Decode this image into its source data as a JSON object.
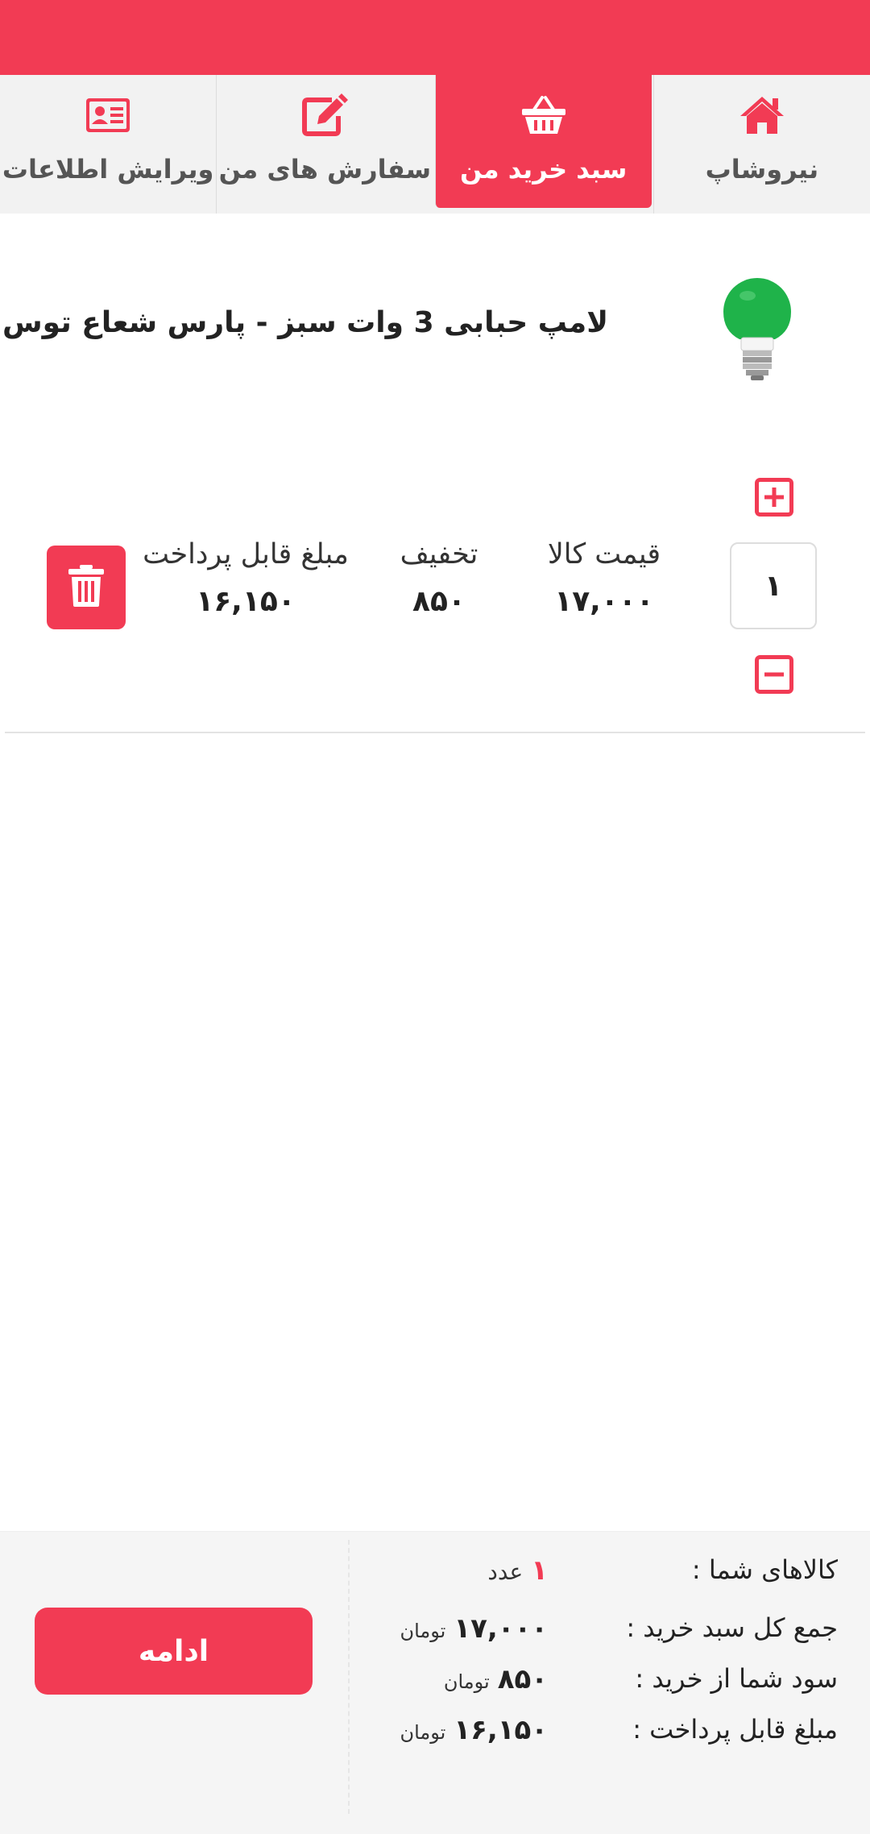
{
  "tabs": [
    {
      "label": "نیروشاپ",
      "icon": "home-icon"
    },
    {
      "label": "سبد خرید من",
      "icon": "basket-icon"
    },
    {
      "label": "سفارش های من",
      "icon": "edit-icon"
    },
    {
      "label": "ویرایش اطلاعات",
      "icon": "id-card-icon"
    }
  ],
  "product": {
    "title": "لامپ حبابی 3 وات سبز - پارس شعاع توس",
    "quantity": "۱",
    "price_label": "قیمت کالا",
    "price": "۱۷,۰۰۰",
    "discount_label": "تخفیف",
    "discount": "۸۵۰",
    "payable_label": "مبلغ قابل پرداخت",
    "payable": "۱۶,۱۵۰"
  },
  "summary": {
    "items_label": "کالاهای شما :",
    "items_count": "۱",
    "items_unit": "عدد",
    "total_label": "جمع کل سبد خرید :",
    "total": "۱۷,۰۰۰",
    "profit_label": "سود شما از خرید :",
    "profit": "۸۵۰",
    "payable_label": "مبلغ قابل پرداخت :",
    "payable": "۱۶,۱۵۰",
    "currency": "تومان",
    "continue_label": "ادامه"
  },
  "colors": {
    "accent": "#f23b54",
    "bulb": "#1fb34a"
  }
}
